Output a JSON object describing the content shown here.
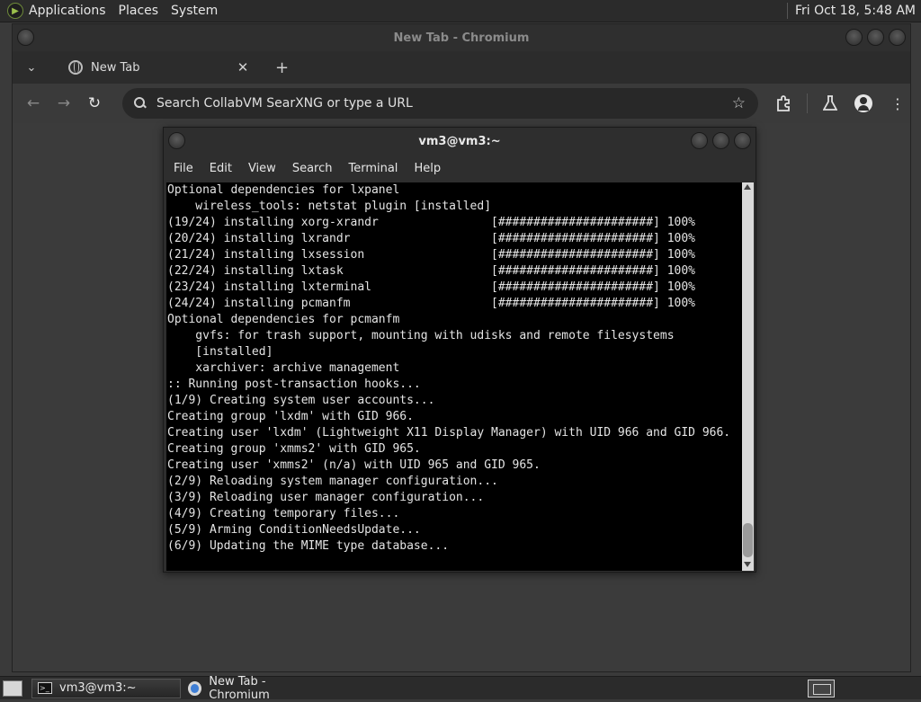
{
  "top_panel": {
    "menus": [
      "Applications",
      "Places",
      "System"
    ],
    "clock": "Fri Oct 18,  5:48 AM"
  },
  "chromium": {
    "window_title": "New Tab - Chromium",
    "tabs": [
      {
        "title": "New Tab",
        "close": "✕"
      }
    ],
    "new_tab": "+",
    "tab_dropdown": "⌄",
    "omnibox_placeholder": "Search CollabVM SearXNG or type a URL",
    "nav": {
      "back": "←",
      "forward": "→",
      "reload": "↻"
    },
    "star": "☆",
    "more": "⋮"
  },
  "terminal": {
    "window_title": "vm3@vm3:~",
    "menu": [
      "File",
      "Edit",
      "View",
      "Search",
      "Terminal",
      "Help"
    ],
    "lines": [
      "Optional dependencies for lxpanel",
      "    wireless_tools: netstat plugin [installed]",
      "(19/24) installing xorg-xrandr                [######################] 100%",
      "(20/24) installing lxrandr                    [######################] 100%",
      "(21/24) installing lxsession                  [######################] 100%",
      "(22/24) installing lxtask                     [######################] 100%",
      "(23/24) installing lxterminal                 [######################] 100%",
      "(24/24) installing pcmanfm                    [######################] 100%",
      "Optional dependencies for pcmanfm",
      "    gvfs: for trash support, mounting with udisks and remote filesystems",
      "    [installed]",
      "    xarchiver: archive management",
      ":: Running post-transaction hooks...",
      "(1/9) Creating system user accounts...",
      "Creating group 'lxdm' with GID 966.",
      "Creating user 'lxdm' (Lightweight X11 Display Manager) with UID 966 and GID 966.",
      "Creating group 'xmms2' with GID 965.",
      "Creating user 'xmms2' (n/a) with UID 965 and GID 965.",
      "(2/9) Reloading system manager configuration...",
      "(3/9) Reloading user manager configuration...",
      "(4/9) Creating temporary files...",
      "(5/9) Arming ConditionNeedsUpdate...",
      "(6/9) Updating the MIME type database..."
    ]
  },
  "taskbar": {
    "items": [
      {
        "label": "vm3@vm3:~",
        "icon": "terminal-icon"
      },
      {
        "label": "New Tab - Chromium",
        "icon": "chromium-icon"
      }
    ]
  }
}
